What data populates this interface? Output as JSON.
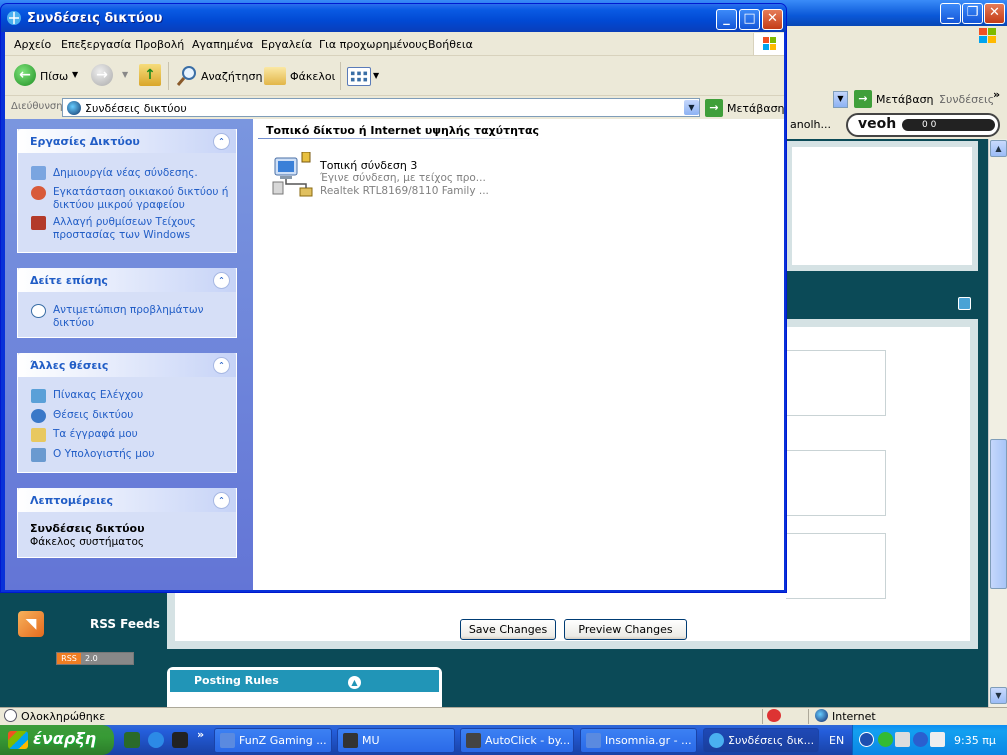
{
  "window": {
    "title": "Συνδέσεις δικτύου",
    "menu": [
      "Αρχείο",
      "Επεξεργασία",
      "Προβολή",
      "Αγαπημένα",
      "Εργαλεία",
      "Για προχωρημένους",
      "Βοήθεια"
    ]
  },
  "toolbar": {
    "back_label": "Πίσω",
    "search_label": "Αναζήτηση",
    "folders_label": "Φάκελοι"
  },
  "address": {
    "label": "Διεύθυνση",
    "value": "Συνδέσεις δικτύου",
    "go_label": "Μετάβαση"
  },
  "tasks": {
    "network": {
      "title": "Εργασίες Δικτύου",
      "items": [
        "Δημιουργία νέας σύνδεσης.",
        "Εγκατάσταση οικιακού δικτύου ή δικτύου μικρού γραφείου",
        "Αλλαγή ρυθμίσεων Τείχους προστασίας των Windows"
      ]
    },
    "see_also": {
      "title": "Δείτε επίσης",
      "items": [
        "Αντιμετώπιση προβλημάτων δικτύου"
      ]
    },
    "other_places": {
      "title": "Άλλες θέσεις",
      "items": [
        "Πίνακας Ελέγχου",
        "Θέσεις δικτύου",
        "Τα έγγραφά μου",
        "Ο Υπολογιστής μου"
      ]
    },
    "details": {
      "title": "Λεπτομέρειες",
      "name": "Συνδέσεις δικτύου",
      "type": "Φάκελος συστήματος"
    }
  },
  "content": {
    "group_title": "Τοπικό δίκτυο ή Internet υψηλής ταχύτητας",
    "connection": {
      "name": "Τοπική σύνδεση 3",
      "status": "Έγινε σύνδεση, με τείχος προ...",
      "device": "Realtek RTL8169/8110 Family ..."
    }
  },
  "background": {
    "go_label": "Μετάβαση",
    "links_label": "Συνδέσεις",
    "toolbar_text": "anolh...",
    "veoh_logo": "veoh",
    "veoh_counts": "0     0",
    "save_button": "Save Changes",
    "preview_button": "Preview Changes",
    "rss_label": "RSS Feeds",
    "rss_badge_a": "RSS",
    "rss_badge_b": "2.0",
    "posting_rules": "Posting Rules",
    "status_text": "Ολοκληρώθηκε",
    "status_zone": "Internet"
  },
  "taskbar": {
    "start_label": "έναρξη",
    "buttons": [
      {
        "label": "FunZ Gaming ..."
      },
      {
        "label": "MU"
      },
      {
        "label": "AutoClick - by..."
      },
      {
        "label": "Insomnia.gr - ..."
      },
      {
        "label": "Συνδέσεις δικ..."
      }
    ],
    "lang": "EN",
    "clock": "9:35 πμ"
  },
  "colors": {
    "xp_blue": "#0a5be4",
    "task_link": "#215dc6",
    "forum_teal": "#0b4a57",
    "start_green": "#379a35"
  }
}
